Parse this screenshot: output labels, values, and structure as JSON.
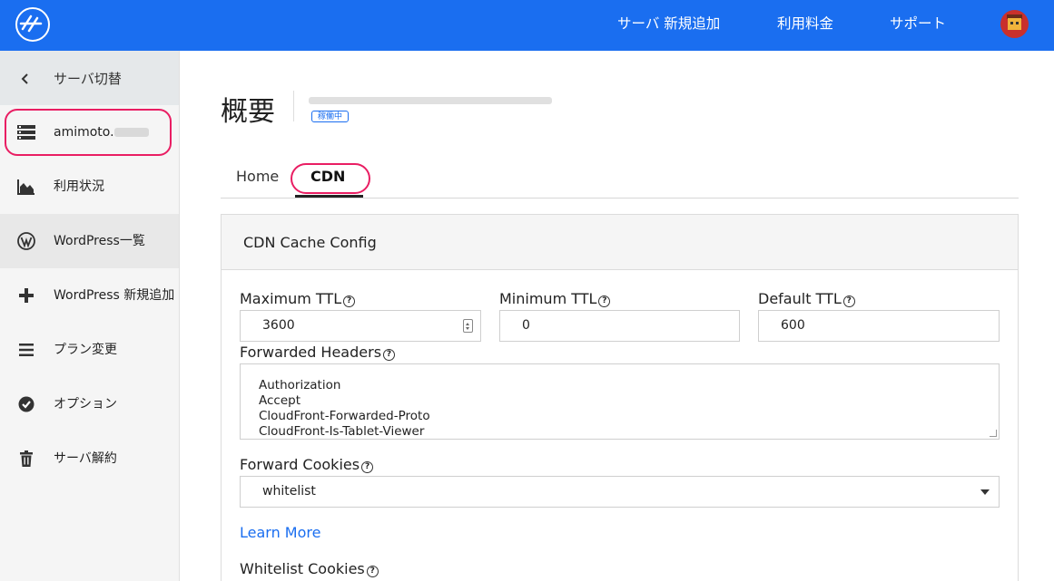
{
  "header": {
    "nav": {
      "add_server": "サーバ 新規追加",
      "pricing": "利用料金",
      "support": "サポート"
    }
  },
  "sidebar": {
    "back_label": "サーバ切替",
    "server_name": "amimoto.",
    "items": [
      {
        "label": "利用状況",
        "icon": "chart-area-icon"
      },
      {
        "label": "WordPress一覧",
        "icon": "wordpress-icon"
      },
      {
        "label": "WordPress 新規追加",
        "icon": "plus-icon"
      },
      {
        "label": "プラン変更",
        "icon": "menu-icon"
      },
      {
        "label": "オプション",
        "icon": "check-circle-icon"
      },
      {
        "label": "サーバ解約",
        "icon": "trash-icon"
      }
    ]
  },
  "page": {
    "title": "概要",
    "status": "稼働中",
    "tabs": {
      "home": "Home",
      "cdn": "CDN"
    }
  },
  "cdn_config": {
    "title": "CDN Cache Config",
    "max_ttl_label": "Maximum TTL",
    "max_ttl_value": "3600",
    "min_ttl_label": "Minimum TTL",
    "min_ttl_value": "0",
    "default_ttl_label": "Default TTL",
    "default_ttl_value": "600",
    "forwarded_headers_label": "Forwarded Headers",
    "forwarded_headers": [
      "Authorization",
      "Accept",
      "CloudFront-Forwarded-Proto",
      "CloudFront-Is-Tablet-Viewer"
    ],
    "forward_cookies_label": "Forward Cookies",
    "forward_cookies_value": "whitelist",
    "learn_more": "Learn More",
    "whitelist_cookies_label": "Whitelist Cookies"
  },
  "colors": {
    "brand": "#1a6ef0",
    "highlight": "#e91e63"
  }
}
